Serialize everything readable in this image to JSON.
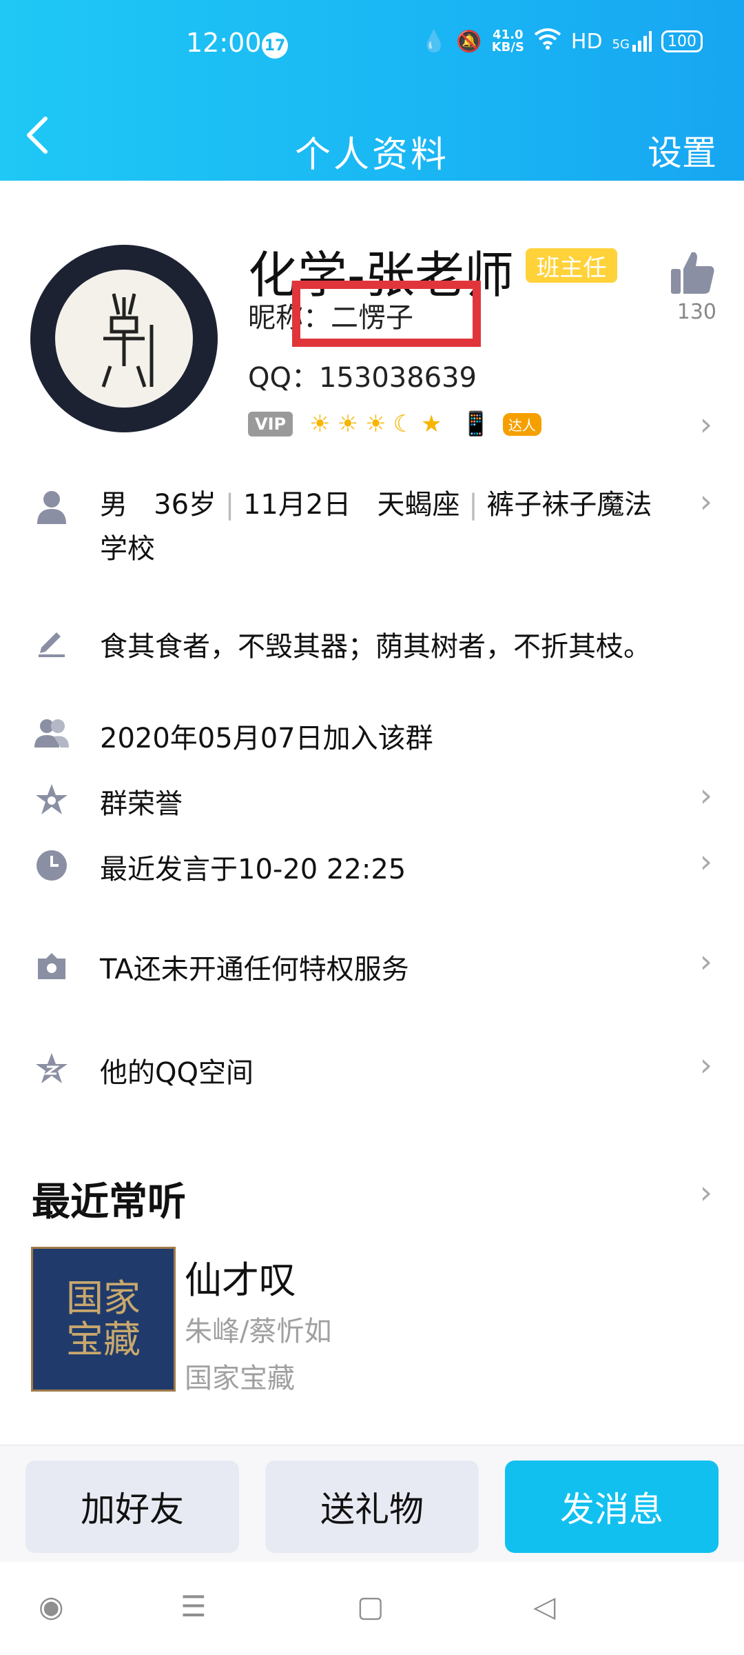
{
  "status_bar": {
    "time": "12:00",
    "notification_count": "17",
    "net_speed_value": "41.0",
    "net_speed_unit": "KB/S",
    "hd": "HD",
    "network": "5G",
    "battery": "100"
  },
  "nav": {
    "title": "个人资料",
    "settings": "设置"
  },
  "profile": {
    "name": "化学-张老师",
    "role_tag": "班主任",
    "nickname": "昵称：二愣子",
    "qq": "QQ：153038639",
    "vip": "VIP",
    "daren": "达人",
    "like_count": "130"
  },
  "info": {
    "gender": "男",
    "age": "36岁",
    "birthday": "11月2日",
    "zodiac": "天蝎座",
    "school_line": "裤子袜子魔法学校",
    "signature": "食其食者，不毁其器；荫其树者，不折其枝。",
    "joined": "2020年05月07日加入该群",
    "honor": "群荣誉",
    "last_speak": "最近发言于10-20 22:25",
    "privilege": "TA还未开通任何特权服务",
    "qzone": "他的QQ空间"
  },
  "recent_listen": {
    "title": "最近常听",
    "song": "仙才叹",
    "artist": "朱峰/蔡忻如",
    "album": "国家宝藏",
    "cover_text": "国家宝藏"
  },
  "actions": {
    "add_friend": "加好友",
    "send_gift": "送礼物",
    "send_message": "发消息"
  },
  "colors": {
    "header": "#1ab7f4",
    "primary_button": "#12c0f0",
    "role_tag": "#ffd23a",
    "highlight_box": "#e0363b"
  }
}
